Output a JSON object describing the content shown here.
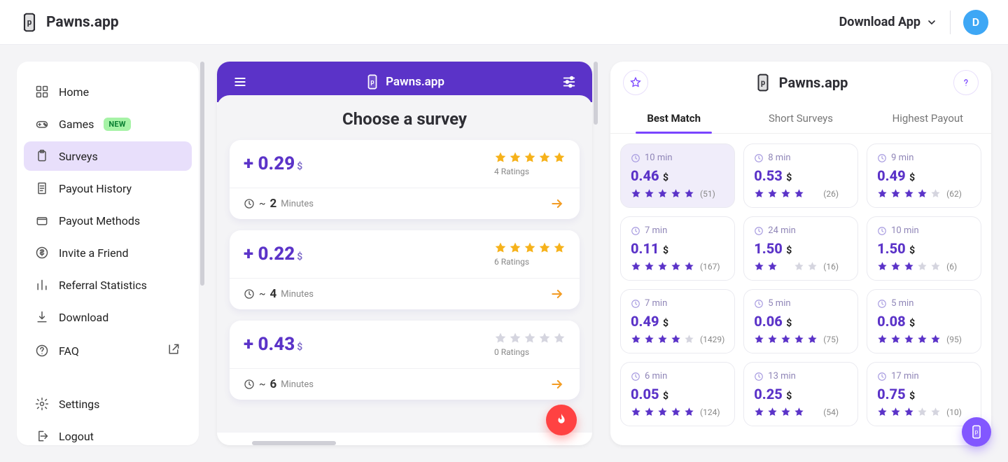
{
  "header": {
    "brand": "Pawns.app",
    "download_label": "Download App",
    "avatar_letter": "D"
  },
  "sidebar": {
    "items": [
      {
        "label": "Home",
        "icon": "grid-icon"
      },
      {
        "label": "Games",
        "icon": "gamepad-icon",
        "badge": "NEW"
      },
      {
        "label": "Surveys",
        "icon": "clipboard-icon",
        "active": true
      },
      {
        "label": "Payout History",
        "icon": "receipt-icon"
      },
      {
        "label": "Payout Methods",
        "icon": "wallet-icon"
      },
      {
        "label": "Invite a Friend",
        "icon": "dollar-icon"
      },
      {
        "label": "Referral Statistics",
        "icon": "bars-icon"
      },
      {
        "label": "Download",
        "icon": "download-icon"
      },
      {
        "label": "FAQ",
        "icon": "help-icon",
        "external": true
      }
    ],
    "footer": [
      {
        "label": "Settings",
        "icon": "gear-icon"
      },
      {
        "label": "Logout",
        "icon": "logout-icon"
      }
    ]
  },
  "phone": {
    "brand": "Pawns.app",
    "title": "Choose a survey",
    "minutes_unit": "Minutes",
    "currency": "$",
    "surveys": [
      {
        "reward": "+ 0.29",
        "ratings_count": "4 Ratings",
        "stars": 5,
        "minutes": "2"
      },
      {
        "reward": "+ 0.22",
        "ratings_count": "6 Ratings",
        "stars": 5,
        "minutes": "4"
      },
      {
        "reward": "+ 0.43",
        "ratings_count": "0 Ratings",
        "stars": 0,
        "minutes": "6"
      }
    ]
  },
  "right": {
    "brand": "Pawns.app",
    "tabs": [
      {
        "label": "Best Match",
        "active": true
      },
      {
        "label": "Short Surveys"
      },
      {
        "label": "Highest Payout"
      }
    ],
    "currency": "$",
    "cards": [
      {
        "time": "10 min",
        "reward": "0.46",
        "stars": 5,
        "count": "(51)",
        "first": true
      },
      {
        "time": "8 min",
        "reward": "0.53",
        "stars": 4.5,
        "count": "(26)"
      },
      {
        "time": "9 min",
        "reward": "0.49",
        "stars": 4,
        "count": "(62)"
      },
      {
        "time": "7 min",
        "reward": "0.11",
        "stars": 5,
        "count": "(167)"
      },
      {
        "time": "24 min",
        "reward": "1.50",
        "stars": 2.5,
        "count": "(16)"
      },
      {
        "time": "10 min",
        "reward": "1.50",
        "stars": 3,
        "count": "(6)"
      },
      {
        "time": "7 min",
        "reward": "0.49",
        "stars": 4,
        "count": "(1429)"
      },
      {
        "time": "5 min",
        "reward": "0.06",
        "stars": 5,
        "count": "(75)"
      },
      {
        "time": "5 min",
        "reward": "0.08",
        "stars": 5,
        "count": "(95)"
      },
      {
        "time": "6 min",
        "reward": "0.05",
        "stars": 5,
        "count": "(124)"
      },
      {
        "time": "13 min",
        "reward": "0.25",
        "stars": 4.5,
        "count": "(54)"
      },
      {
        "time": "17 min",
        "reward": "0.75",
        "stars": 3,
        "count": "(10)"
      }
    ]
  }
}
